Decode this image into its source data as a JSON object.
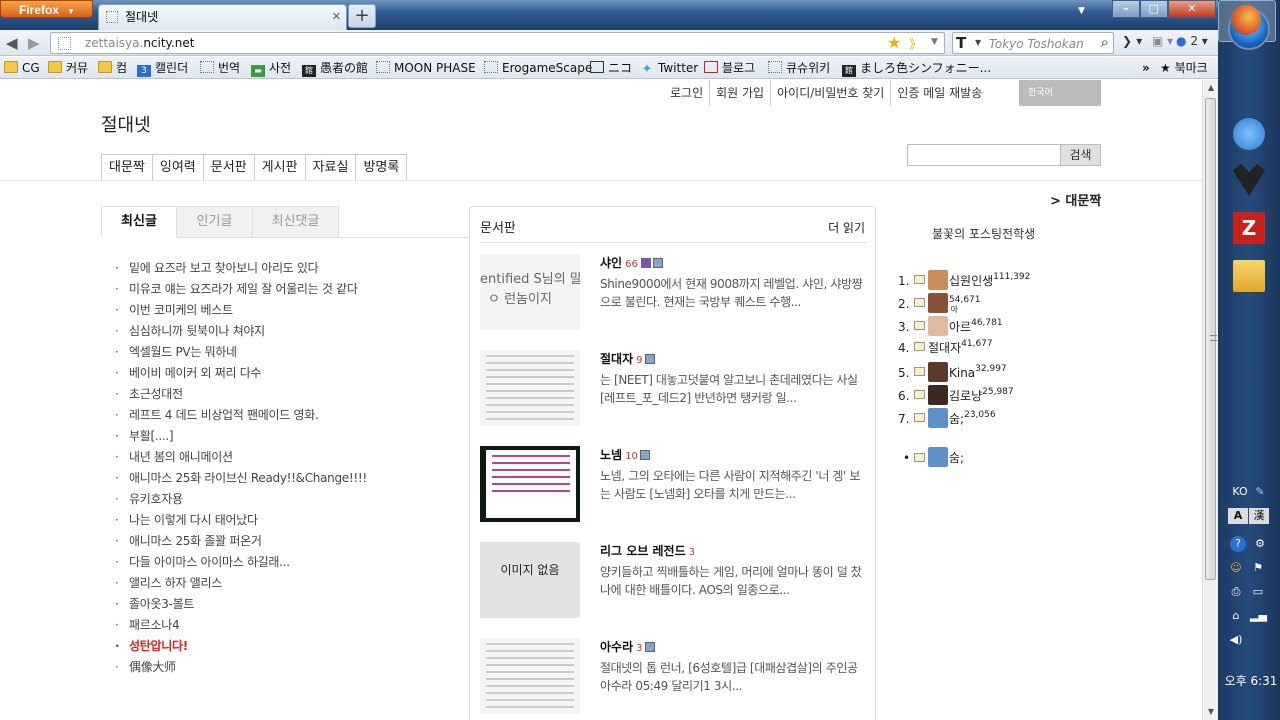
{
  "browser": {
    "app_button": "Firefox",
    "tab_title": "절대넷",
    "url_prefix": "zettaisya.",
    "url_domain": "ncity.net",
    "search_engine_placeholder": "Tokyo Toshokan",
    "tab_count_badge": "2",
    "bookmarks": [
      "CG",
      "커뮤",
      "컴",
      "캘린더",
      "번역",
      "사전",
      "愚者の館",
      "MOON PHASE",
      "ErogameScape",
      "ニコ",
      "Twitter",
      "블로그",
      "큐슈위키",
      "ましろ色シンフォニー..."
    ],
    "bookmark_cal_num": "3",
    "bookmarks_menu": "북마크",
    "new_tab": "+",
    "min": "–",
    "max": "□",
    "close": "✕"
  },
  "site": {
    "top_links": [
      "로그인",
      "회원 가입",
      "아이디/비밀번호 찾기",
      "인증 메일 재발송"
    ],
    "language": "한국어",
    "title": "절대넷",
    "menu": [
      "대문짝",
      "잉여력",
      "문서판",
      "게시판",
      "자료실",
      "방명록"
    ],
    "search_button": "검색"
  },
  "left": {
    "tabs": [
      "최신글",
      "인기글",
      "최신댓글"
    ],
    "posts": [
      {
        "text": "밑에 요즈라 보고 찾아보니 아리도 있다",
        "hot": false
      },
      {
        "text": "미유코 얘는 요즈라가 제일 잘 어울리는 것 같다",
        "hot": false
      },
      {
        "text": "이번 코미케의 베스트",
        "hot": false
      },
      {
        "text": "심심하니까 뒷북이나 쳐야지",
        "hot": false
      },
      {
        "text": "엑셀월드 PV는 뭐하네",
        "hot": false
      },
      {
        "text": "베이비 메이커 외 쩌리 다수",
        "hot": false
      },
      {
        "text": "초근성대전",
        "hot": false
      },
      {
        "text": "레프트 4 데드 비상업적 팬메이드 영화.",
        "hot": false
      },
      {
        "text": "부활[....]",
        "hot": false
      },
      {
        "text": "내년 봄의 애니메이션",
        "hot": false
      },
      {
        "text": "애니마스 25화 라이브신 Ready!!&Change!!!!",
        "hot": false
      },
      {
        "text": "유키호자용",
        "hot": false
      },
      {
        "text": "나는 이렇게 다시 태어났다",
        "hot": false
      },
      {
        "text": "애니마스 25화 졸꽐 퍼온거",
        "hot": false
      },
      {
        "text": "다들 아이마스 아이마스 하길래...",
        "hot": false
      },
      {
        "text": "앨리스 하자 앨리스",
        "hot": false
      },
      {
        "text": "졸아옷3-볼트",
        "hot": false
      },
      {
        "text": "패르소나4",
        "hot": false
      },
      {
        "text": "성탄압니다!",
        "hot": true
      },
      {
        "text": "偶像大师",
        "hot": false
      }
    ]
  },
  "docs": {
    "title": "문서판",
    "more": "더 읽기",
    "items": [
      {
        "name": "샤인",
        "count": "66",
        "thumb_text": "entified S님의 말",
        "thumb_text2": "ㅇ 런놈이지",
        "desc": "Shine9000에서 현재 9008까지 레벨업. 샤인, 샤방쨩으로 불린다. 현재는 국방부 퀘스트 수행..."
      },
      {
        "name": "절대자",
        "count": "9",
        "desc": "는 [NEET] 대놓고덧붙여 알고보니 촌데레였다는 사실 [레프트_포_데드2] 반년하면 탱커랑 일..."
      },
      {
        "name": "노넴",
        "count": "10",
        "desc": "노넴, 그의 오타에는 다른 사람이 지적해주긴 '너 겡' 보는 사람도 [노넴화] 오타를 치게 만드는..."
      },
      {
        "name": "리그 오브 레전드",
        "count": "3",
        "thumb_text": "이미지 없음",
        "desc": "양키들하고 찍배틀하는 게임, 머리에 얼마나 똥이 덜 찼나에 대한 배틀이다. AOS의 일종으로..."
      },
      {
        "name": "아수라",
        "count": "3",
        "desc": "절대넷의 톱 런너, [6성호텔]급 [대패삼겹살]의 주인공 아수라 05:49 달리기1 3시..."
      }
    ]
  },
  "right": {
    "section_link": "> 대문짝",
    "subtitle": "불꽃의 포스팅전학생",
    "ranking": [
      {
        "rank": "1.",
        "name": "십원인생",
        "score": "111,392",
        "avatar": "#c98d5a"
      },
      {
        "rank": "2.",
        "name": "",
        "score": "54,671",
        "extra": "아",
        "avatar": "#8a5038"
      },
      {
        "rank": "3.",
        "name": "아르",
        "score": "46,781",
        "avatar": "#e0b9a0"
      },
      {
        "rank": "4.",
        "name": "절대자",
        "score": "41,677",
        "avatar": ""
      },
      {
        "rank": "5.",
        "name": "Kina",
        "score": "32,997",
        "avatar": "#5a3a2a"
      },
      {
        "rank": "6.",
        "name": "김로냥",
        "score": "25,987",
        "avatar": "#3a2a22"
      },
      {
        "rank": "7.",
        "name": "숨;",
        "score": "23,056",
        "avatar": "#5d8fc9"
      }
    ],
    "online": "숨;"
  },
  "taskbar": {
    "lang": "KO",
    "clock": "오후 6:31"
  }
}
